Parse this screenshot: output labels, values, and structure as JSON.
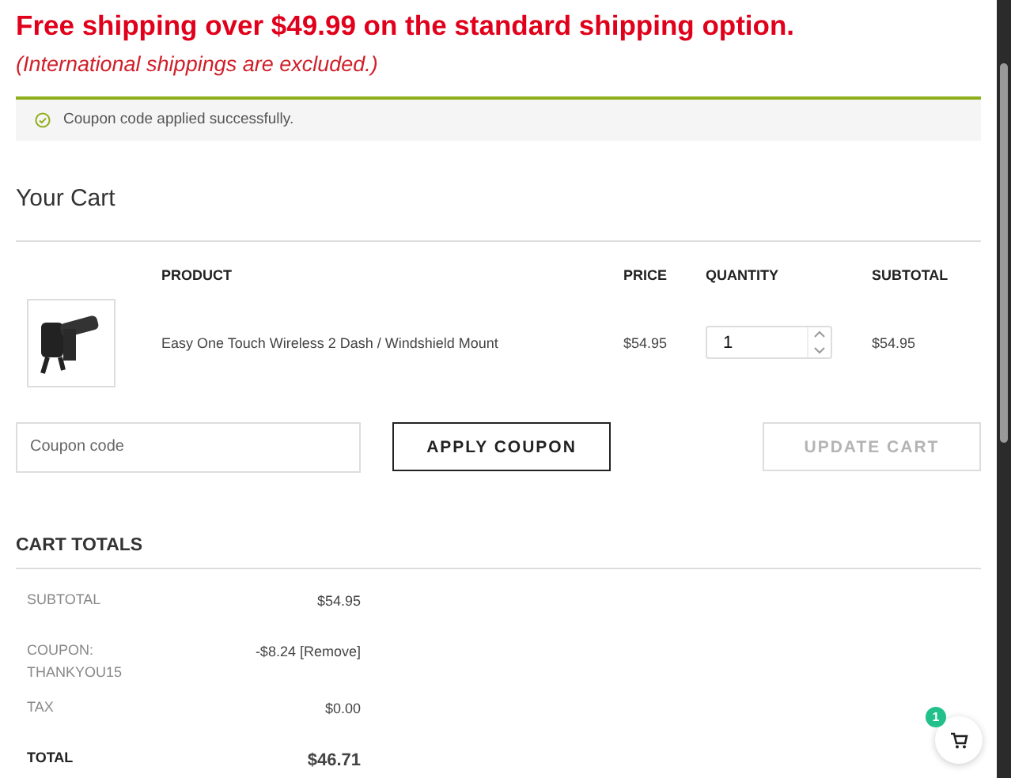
{
  "notice": {
    "headline": "Free shipping over $49.99 on the standard shipping option.",
    "note": "(International shippings are excluded.)"
  },
  "message": {
    "kind": "success",
    "text": "Coupon code applied successfully."
  },
  "cart": {
    "title": "Your Cart",
    "columns": [
      "PRODUCT",
      "PRICE",
      "QUANTITY",
      "SUBTOTAL"
    ],
    "rows": [
      {
        "product": "Easy One Touch Wireless 2 Dash / Windshield Mount",
        "price": "$54.95",
        "quantity": "1",
        "subtotal": "$54.95"
      }
    ]
  },
  "coupon": {
    "placeholder": "Coupon code",
    "apply": "APPLY COUPON",
    "update": "UPDATE CART",
    "update_disabled": true
  },
  "totals": {
    "title": "CART TOTALS",
    "rows": [
      {
        "label": "SUBTOTAL",
        "value": "$54.95",
        "kind": "plain"
      },
      {
        "label": "COUPON: THANKYOU15",
        "value": "-$8.24",
        "link": "[Remove]",
        "kind": "coupon"
      },
      {
        "label": "TAX",
        "value": "$0.00",
        "kind": "plain"
      },
      {
        "label": "TOTAL",
        "value": "$46.71",
        "kind": "total"
      }
    ]
  },
  "cart_button": {
    "count": "1"
  }
}
